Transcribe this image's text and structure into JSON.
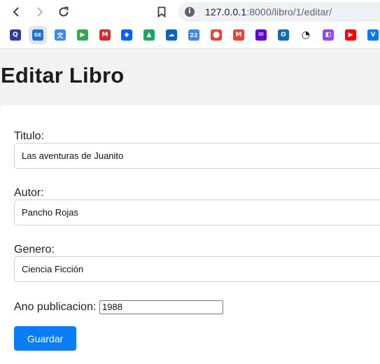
{
  "browser": {
    "url_host": "127.0.0.1",
    "url_rest": ":8000/libro/1/editar/",
    "site_info_glyph": "i",
    "bookmarks": [
      {
        "icon": "quizlet-icon",
        "glyph": "Q",
        "color": "#2a3da3"
      },
      {
        "icon": "google-forms-edit-icon",
        "glyph": "GE",
        "color": "#1e6fd9"
      },
      {
        "icon": "google-translate-icon",
        "glyph": "文",
        "color": "#4285f4"
      },
      {
        "icon": "google-play-icon",
        "glyph": "▶",
        "color": "#34a853"
      },
      {
        "icon": "mega-icon",
        "glyph": "M",
        "color": "#d9272e"
      },
      {
        "icon": "dropbox-icon",
        "glyph": "◆",
        "color": "#0061fe"
      },
      {
        "icon": "google-drive-icon",
        "glyph": "▲",
        "color": "#1fa463"
      },
      {
        "icon": "onedrive-icon",
        "glyph": "☁",
        "color": "#0364b8"
      },
      {
        "icon": "google-calendar-icon",
        "glyph": "22",
        "color": "#4285f4"
      },
      {
        "icon": "google-maps-icon",
        "glyph": "⬤",
        "color": "#ea4335"
      },
      {
        "icon": "gmail-icon",
        "glyph": "M",
        "color": "#ea4335"
      },
      {
        "icon": "yahoo-mail-icon",
        "glyph": "✉",
        "color": "#6001d2"
      },
      {
        "icon": "outlook-icon",
        "glyph": "O",
        "color": "#0f6cbd"
      },
      {
        "icon": "clock-icon",
        "glyph": "◔",
        "color": "#202124"
      },
      {
        "icon": "twitch-icon",
        "glyph": "◧",
        "color": "#9146ff"
      },
      {
        "icon": "youtube-icon",
        "glyph": "▶",
        "color": "#ff0000"
      },
      {
        "icon": "vk-icon",
        "glyph": "V",
        "color": "#0077ff"
      }
    ]
  },
  "page": {
    "title": "Editar Libro"
  },
  "form": {
    "titulo_label": "Titulo:",
    "titulo_value": "Las aventuras de Juanito",
    "autor_label": "Autor:",
    "autor_value": "Pancho Rojas",
    "genero_label": "Genero:",
    "genero_value": "Ciencia Ficción",
    "anio_label": "Ano publicacion:",
    "anio_value": "1988",
    "save_label": "Guardar"
  },
  "colors": {
    "primary_button": "#0a7cf5",
    "page_background": "#f2f2f2"
  }
}
